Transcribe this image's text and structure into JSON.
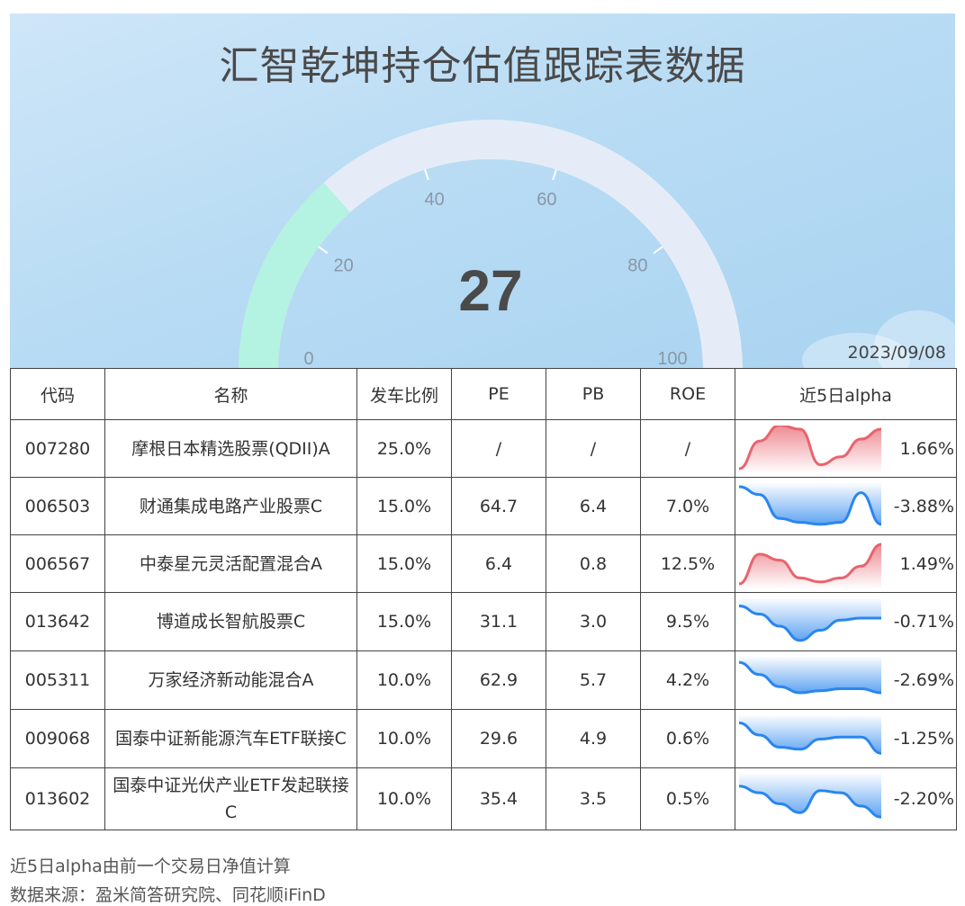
{
  "header": {
    "title": "汇智乾坤持仓估值跟踪表数据",
    "date": "2023/09/08"
  },
  "gauge": {
    "value": 27,
    "value_text": "27",
    "min": 0,
    "max": 100,
    "ticks": [
      "0",
      "20",
      "40",
      "60",
      "80",
      "100"
    ],
    "fill_color": "#b4f2e1",
    "track_color": "#e6ecf7"
  },
  "table": {
    "headers": [
      "代码",
      "名称",
      "发车比例",
      "PE",
      "PB",
      "ROE",
      "近5日alpha"
    ],
    "rows": [
      {
        "code": "007280",
        "name": "摩根日本精选股票(QDII)A",
        "ratio": "25.0%",
        "pe": "/",
        "pb": "/",
        "roe": "/",
        "alpha": "1.66%",
        "trend": [
          -1.0,
          0.4,
          1.2,
          1.0,
          -0.8,
          -0.4,
          0.5,
          1.0
        ],
        "color": "#e8646e"
      },
      {
        "code": "006503",
        "name": "财通集成电路产业股票C",
        "ratio": "15.0%",
        "pe": "64.7",
        "pb": "6.4",
        "roe": "7.0%",
        "alpha": "-3.88%",
        "trend": [
          1.0,
          0.6,
          -0.6,
          -0.8,
          -0.9,
          -0.8,
          0.7,
          -0.9
        ],
        "color": "#2a86ee"
      },
      {
        "code": "006567",
        "name": "中泰星元灵活配置混合A",
        "ratio": "15.0%",
        "pe": "6.4",
        "pb": "0.8",
        "roe": "12.5%",
        "alpha": "1.49%",
        "trend": [
          -1.0,
          0.5,
          0.2,
          -0.7,
          -0.9,
          -0.7,
          -0.1,
          1.0
        ],
        "color": "#e8646e"
      },
      {
        "code": "013642",
        "name": "博道成长智航股票C",
        "ratio": "15.0%",
        "pe": "31.1",
        "pb": "3.0",
        "roe": "9.5%",
        "alpha": "-0.71%",
        "trend": [
          0.8,
          0.4,
          -0.2,
          -0.9,
          -0.4,
          0.1,
          0.2,
          0.2
        ],
        "color": "#2a86ee"
      },
      {
        "code": "005311",
        "name": "万家经济新动能混合A",
        "ratio": "10.0%",
        "pe": "62.9",
        "pb": "5.7",
        "roe": "4.2%",
        "alpha": "-2.69%",
        "trend": [
          0.9,
          0.3,
          -0.3,
          -0.6,
          -0.5,
          -0.4,
          -0.4,
          -0.6
        ],
        "color": "#2a86ee"
      },
      {
        "code": "009068",
        "name": "国泰中证新能源汽车ETF联接C",
        "ratio": "10.0%",
        "pe": "29.6",
        "pb": "4.9",
        "roe": "0.6%",
        "alpha": "-1.25%",
        "trend": [
          0.8,
          0.2,
          -0.4,
          -0.5,
          0.0,
          0.1,
          0.1,
          -0.7
        ],
        "color": "#2a86ee"
      },
      {
        "code": "013602",
        "name": "国泰中证光伏产业ETF发起联接C",
        "ratio": "10.0%",
        "pe": "35.4",
        "pb": "3.5",
        "roe": "0.5%",
        "alpha": "-2.20%",
        "trend": [
          0.6,
          0.3,
          -0.2,
          -0.6,
          0.4,
          0.3,
          -0.3,
          -0.8
        ],
        "color": "#2a86ee"
      }
    ]
  },
  "footer": {
    "note": "近5日alpha由前一个交易日净值计算",
    "source": "数据来源：盈米简答研究院、同花顺iFinD"
  }
}
